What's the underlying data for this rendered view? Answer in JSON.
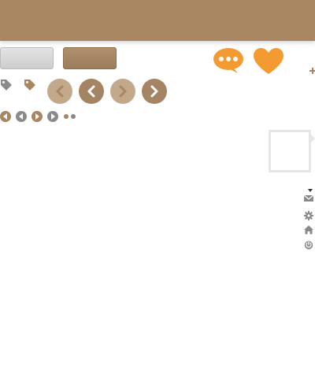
{
  "colors": {
    "brand_brown": "#a88661",
    "brown_dark": "#a48462",
    "brown_light": "#c2a98c",
    "orange": "#f39a31",
    "grey_icon": "#8a8a8a",
    "grey_light": "#cfcfcf"
  },
  "header": {
    "background": "#a88661"
  },
  "icons": {
    "chat": "chat-bubble-icon",
    "heart": "heart-icon",
    "plus": "plus-icon",
    "tag": "tag-icon",
    "chevron_left": "chevron-left-icon",
    "chevron_right": "chevron-right-icon",
    "mail": "envelope-icon",
    "gear": "gear-icon",
    "home": "home-icon",
    "power": "power-icon",
    "caret": "caret-down-icon"
  }
}
